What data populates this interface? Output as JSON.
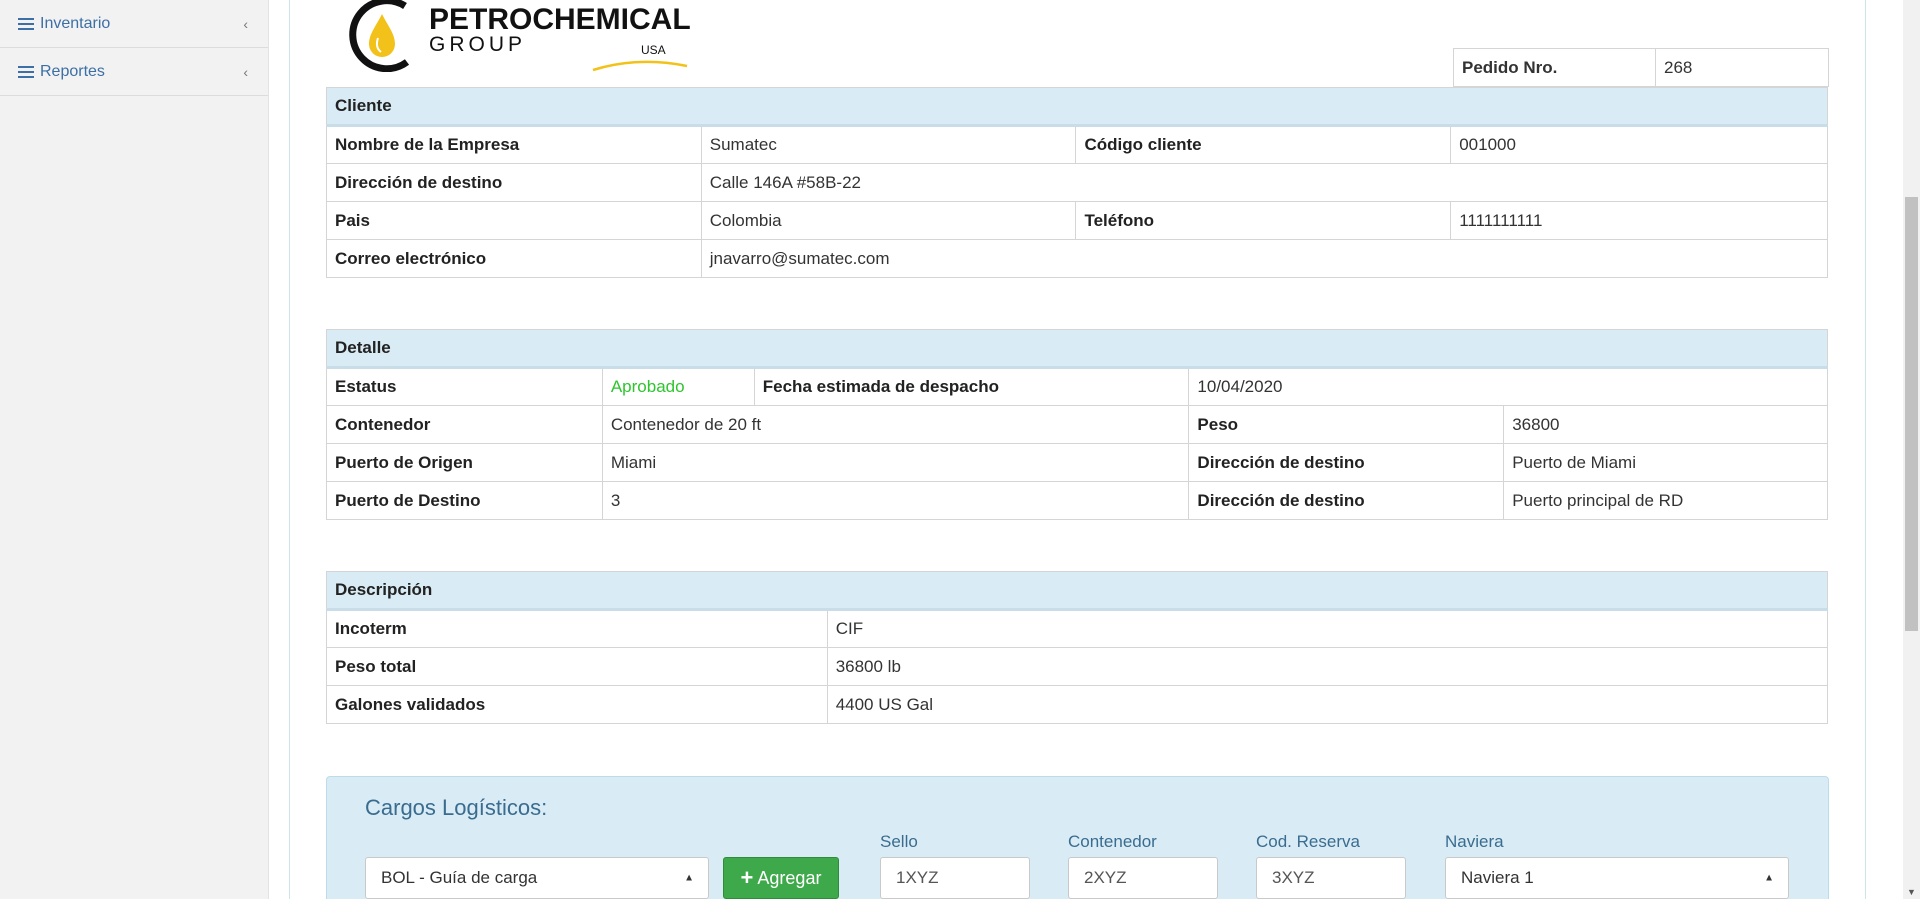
{
  "sidebar": {
    "items": [
      {
        "label": "Inventario"
      },
      {
        "label": "Reportes"
      }
    ]
  },
  "logo": {
    "title": "PETROCHEMICAL",
    "group": "GROUP",
    "usa": "USA"
  },
  "pedido": {
    "label": "Pedido Nro.",
    "value": "268"
  },
  "cliente": {
    "section": "Cliente",
    "empresa_label": "Nombre de la Empresa",
    "empresa_value": "Sumatec",
    "codigo_label": "Código cliente",
    "codigo_value": "001000",
    "direccion_label": "Dirección de destino",
    "direccion_value": "Calle 146A #58B-22",
    "pais_label": "Pais",
    "pais_value": "Colombia",
    "telefono_label": "Teléfono",
    "telefono_value": "1111111111",
    "correo_label": "Correo electrónico",
    "correo_value": "jnavarro@sumatec.com"
  },
  "detalle": {
    "section": "Detalle",
    "estatus_label": "Estatus",
    "estatus_value": "Aprobado",
    "estatus_color": "#2ec52e",
    "fecha_label": "Fecha estimada de despacho",
    "fecha_value": "10/04/2020",
    "contenedor_label": "Contenedor",
    "contenedor_value": "Contenedor de 20 ft",
    "peso_label": "Peso",
    "peso_value": "36800",
    "origen_label": "Puerto de Origen",
    "origen_value": "Miami",
    "dir_origen_label": "Dirección de destino",
    "dir_origen_value": "Puerto de Miami",
    "destino_label": "Puerto de Destino",
    "destino_value": "3",
    "dir_destino_label": "Dirección de destino",
    "dir_destino_value": "Puerto principal de RD"
  },
  "descripcion": {
    "section": "Descripción",
    "incoterm_label": "Incoterm",
    "incoterm_value": "CIF",
    "peso_total_label": "Peso total",
    "peso_total_value": "36800 lb",
    "galones_label": "Galones validados",
    "galones_value": "4400 US Gal"
  },
  "cargos": {
    "title": "Cargos Logísticos:",
    "select_value": "BOL - Guía de carga",
    "add_label": "Agregar",
    "sello_label": "Sello",
    "sello_value": "1XYZ",
    "contenedor_label": "Contenedor",
    "contenedor_value": "2XYZ",
    "reserva_label": "Cod. Reserva",
    "reserva_value": "3XYZ",
    "naviera_label": "Naviera",
    "naviera_value": "Naviera 1"
  }
}
